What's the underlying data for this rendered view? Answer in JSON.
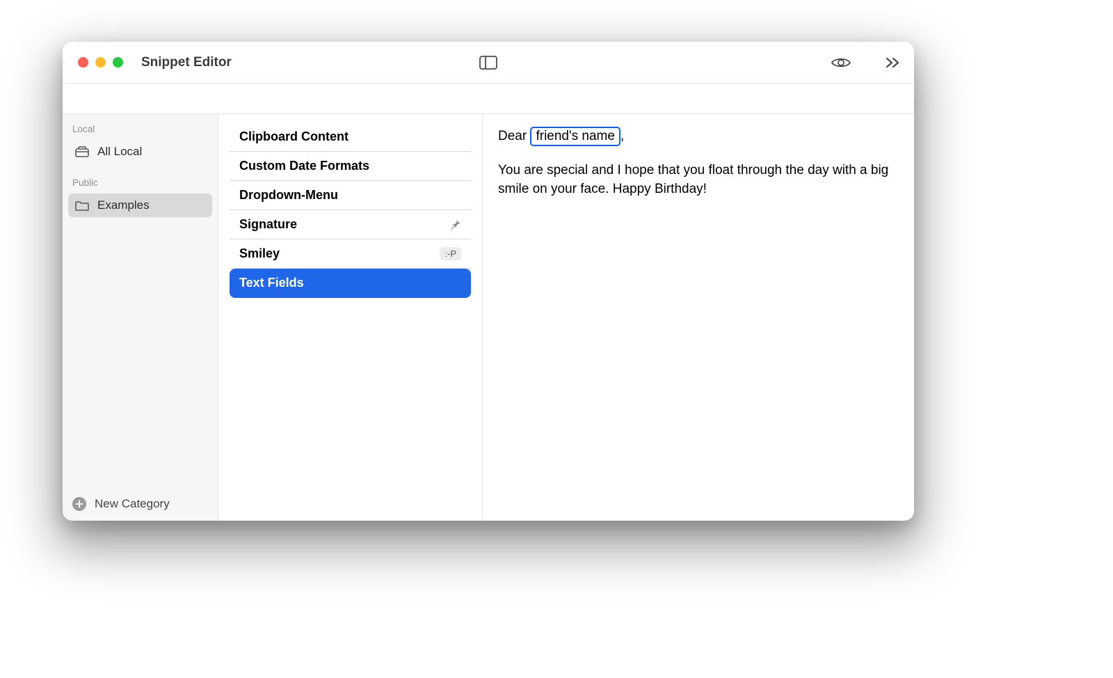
{
  "window": {
    "title": "Snippet Editor"
  },
  "sidebar": {
    "groups": [
      {
        "label": "Local",
        "items": [
          {
            "icon": "tray",
            "label": "All Local",
            "selected": false
          }
        ]
      },
      {
        "label": "Public",
        "items": [
          {
            "icon": "folder",
            "label": "Examples",
            "selected": true
          }
        ]
      }
    ],
    "footer_label": "New Category"
  },
  "snippets": [
    {
      "title": "Clipboard Content",
      "selected": false
    },
    {
      "title": "Custom Date Formats",
      "selected": false
    },
    {
      "title": "Dropdown-Menu",
      "selected": false
    },
    {
      "title": "Signature",
      "selected": false,
      "pin": true
    },
    {
      "title": "Smiley",
      "selected": false,
      "badge": ":-P"
    },
    {
      "title": "Text Fields",
      "selected": true
    }
  ],
  "content": {
    "line1_prefix": "Dear ",
    "token": "friend's name",
    "line1_suffix": ",",
    "paragraph": "You are special and I hope that you float through the day with a big smile on your face. Happy Birthday!"
  }
}
